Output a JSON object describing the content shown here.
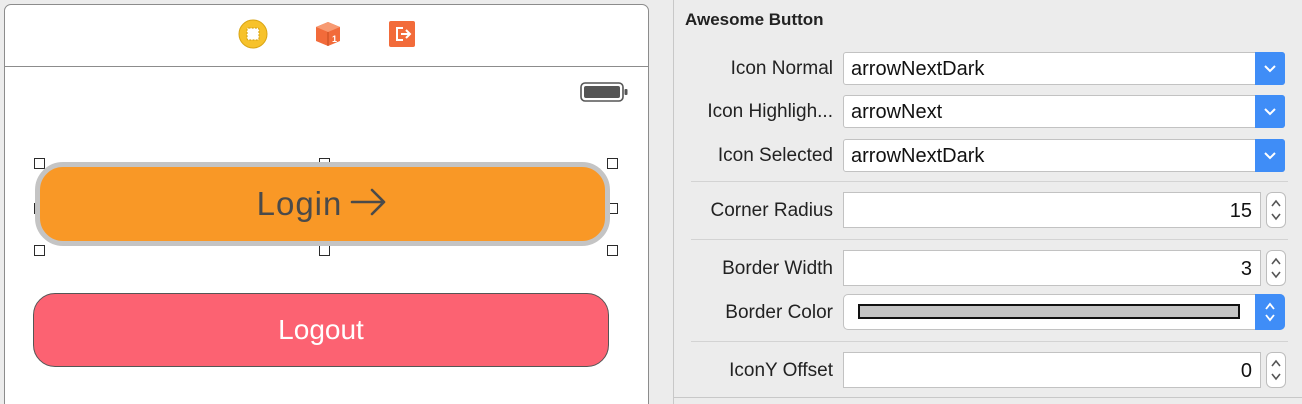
{
  "canvas": {
    "scene_dock": {
      "icons": [
        "view-controller-icon",
        "first-responder-icon",
        "exit-icon"
      ]
    },
    "status_bar": {
      "battery_icon": "battery-icon"
    },
    "login_button": {
      "label": "Login",
      "icon": "arrow-right-icon",
      "color": "#f99826",
      "border_color": "#c4c4c4"
    },
    "logout_button": {
      "label": "Logout",
      "color": "#fc6272"
    }
  },
  "inspector": {
    "title": "Awesome Button",
    "icon_normal": {
      "label": "Icon Normal",
      "value": "arrowNextDark"
    },
    "icon_highlighted": {
      "label": "Icon Highligh...",
      "value": "arrowNext"
    },
    "icon_selected": {
      "label": "Icon Selected",
      "value": "arrowNextDark"
    },
    "corner_radius": {
      "label": "Corner Radius",
      "value": "15"
    },
    "border_width": {
      "label": "Border Width",
      "value": "3"
    },
    "border_color": {
      "label": "Border Color",
      "value": "#c4c4c4"
    },
    "icon_y_offset": {
      "label": "IconY Offset",
      "value": "0"
    },
    "accent_color": "#3f8df7"
  }
}
